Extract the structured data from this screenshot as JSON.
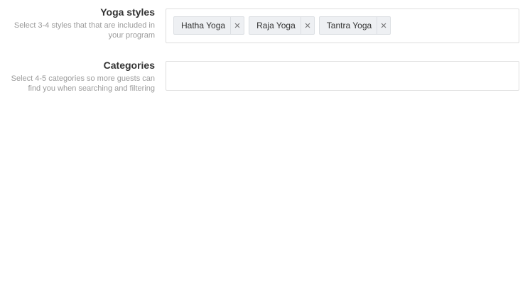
{
  "yoga_styles": {
    "title": "Yoga styles",
    "help_line_1": "Select 3-4 styles that that are included in",
    "help_line_2": "your program",
    "selected": [
      {
        "label": "Hatha Yoga"
      },
      {
        "label": "Raja Yoga"
      },
      {
        "label": "Tantra Yoga"
      }
    ],
    "remove_icon": "close-icon"
  },
  "categories": {
    "title": "Categories",
    "help_line_1": "Select 4-5 categories so more guests can",
    "help_line_2": "find you when searching and filtering",
    "value": ""
  },
  "colors": {
    "tag_background": "#eef0f3",
    "tag_border": "#dcdfe3",
    "field_border": "#dedede",
    "help_text": "#9b9b9b",
    "title_text": "#333333"
  }
}
